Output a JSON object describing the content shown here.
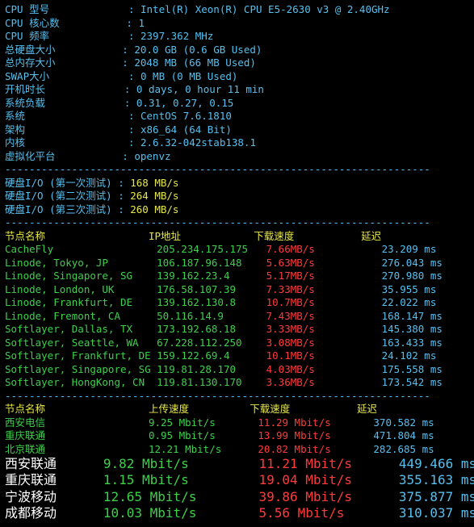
{
  "sys": {
    "labels": {
      "cpu_model": "CPU 型号",
      "cpu_cores": "CPU 核心数",
      "cpu_freq": "CPU 频率",
      "disk": "总硬盘大小",
      "mem": "总内存大小",
      "swap": "SWAP大小",
      "uptime": "开机时长",
      "load": "系统负载",
      "os": "系统",
      "arch": "架构",
      "kernel": "内核",
      "virt": "虚拟化平台"
    },
    "values": {
      "cpu_model": "Intel(R) Xeon(R) CPU E5-2630 v3 @ 2.40GHz",
      "cpu_cores": "1",
      "cpu_freq": "2397.362 MHz",
      "disk": "20.0 GB (0.6 GB Used)",
      "mem": "2048 MB (66 MB Used)",
      "swap": "0 MB (0 MB Used)",
      "uptime": "0 days, 0 hour 11 min",
      "load": "0.31, 0.27, 0.15",
      "os": "CentOS 7.6.1810",
      "arch": "x86_64 (64 Bit)",
      "kernel": "2.6.32-042stab138.1",
      "virt": "openvz"
    }
  },
  "io": {
    "labels": {
      "t1": "硬盘I/O (第一次测试)",
      "t2": "硬盘I/O (第二次测试)",
      "t3": "硬盘I/O (第三次测试)"
    },
    "values": {
      "t1": "168 MB/s",
      "t2": "264 MB/s",
      "t3": "260 MB/s"
    }
  },
  "dl_hdr": {
    "node": "节点名称",
    "ip": "IP地址",
    "speed": "下载速度",
    "lat": "延迟"
  },
  "dl": [
    {
      "node": "CacheFly",
      "ip": "205.234.175.175",
      "speed": "7.66MB/s",
      "lat": "23.209 ms"
    },
    {
      "node": "Linode, Tokyo, JP",
      "ip": "106.187.96.148",
      "speed": "5.63MB/s",
      "lat": "276.043 ms"
    },
    {
      "node": "Linode, Singapore, SG",
      "ip": "139.162.23.4",
      "speed": "5.17MB/s",
      "lat": "270.980 ms"
    },
    {
      "node": "Linode, London, UK",
      "ip": "176.58.107.39",
      "speed": "7.33MB/s",
      "lat": "35.955 ms"
    },
    {
      "node": "Linode, Frankfurt, DE",
      "ip": "139.162.130.8",
      "speed": "10.7MB/s",
      "lat": "22.022 ms"
    },
    {
      "node": "Linode, Fremont, CA",
      "ip": "50.116.14.9",
      "speed": "7.43MB/s",
      "lat": "168.147 ms"
    },
    {
      "node": "Softlayer, Dallas, TX",
      "ip": "173.192.68.18",
      "speed": "3.33MB/s",
      "lat": "145.380 ms"
    },
    {
      "node": "Softlayer, Seattle, WA",
      "ip": "67.228.112.250",
      "speed": "3.08MB/s",
      "lat": "163.433 ms"
    },
    {
      "node": "Softlayer, Frankfurt, DE",
      "ip": "159.122.69.4",
      "speed": "10.1MB/s",
      "lat": "24.102 ms"
    },
    {
      "node": "Softlayer, Singapore, SG",
      "ip": "119.81.28.170",
      "speed": "4.03MB/s",
      "lat": "175.558 ms"
    },
    {
      "node": "Softlayer, HongKong, CN",
      "ip": "119.81.130.170",
      "speed": "3.36MB/s",
      "lat": "173.542 ms"
    }
  ],
  "sp_hdr": {
    "node": "节点名称",
    "up": "上传速度",
    "down": "下载速度",
    "lat": "延迟"
  },
  "sp": [
    {
      "node": "西安电信",
      "up": "9.25 Mbit/s",
      "down": "11.29 Mbit/s",
      "lat": "370.582 ms"
    },
    {
      "node": "重庆联通",
      "up": "0.95 Mbit/s",
      "down": "13.99 Mbit/s",
      "lat": "471.804 ms"
    },
    {
      "node": "北京联通",
      "up": "12.21 Mbit/s",
      "down": "20.82 Mbit/s",
      "lat": "282.685 ms"
    }
  ],
  "big": [
    {
      "node": "西安联通",
      "up": "9.82 Mbit/s",
      "down": "11.21 Mbit/s",
      "lat": "449.466 ms"
    },
    {
      "node": "重庆联通",
      "up": "1.15 Mbit/s",
      "down": "19.04 Mbit/s",
      "lat": "355.163 ms"
    },
    {
      "node": "宁波移动",
      "up": "12.65 Mbit/s",
      "down": "39.86 Mbit/s",
      "lat": "375.877 ms"
    },
    {
      "node": "成都移动",
      "up": "10.03 Mbit/s",
      "down": "5.56 Mbit/s",
      "lat": "310.037 ms"
    }
  ],
  "dash_line": "----------------------------------------------------------------------"
}
